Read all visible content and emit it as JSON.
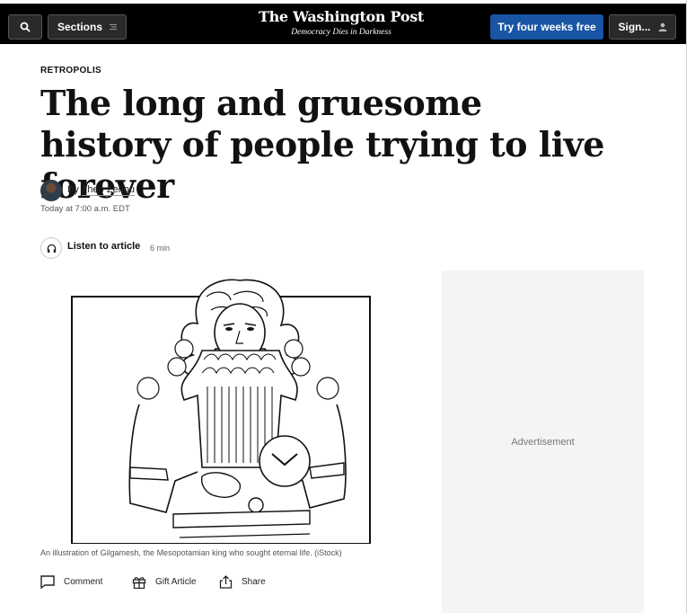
{
  "header": {
    "sections_label": "Sections",
    "logo": "The Washington Post",
    "tagline": "Democracy Dies in Darkness",
    "trial_label": "Try four weeks free",
    "signin_label": "Sign..."
  },
  "article": {
    "kicker": "RETROPOLIS",
    "headline": "The long and gruesome history of people trying to live forever",
    "byline_prefix": "By",
    "author": "Theo Zenou",
    "timestamp": "Today at 7:00 a.m. EDT",
    "listen_label": "Listen to article",
    "listen_duration": "6 min",
    "caption": "An illustration of Gilgamesh, the Mesopotamian king who sought eternal life. (iStock)",
    "actions": {
      "comment": "Comment",
      "gift": "Gift Article",
      "share": "Share"
    }
  },
  "ad": {
    "label": "Advertisement"
  },
  "colors": {
    "header_bg": "#000000",
    "trial_button": "#1955a5",
    "ad_bg": "#f4f4f4"
  },
  "icons": {
    "search": "search-icon",
    "sections": "hamburger-icon",
    "signin": "user-icon",
    "listen": "headphones-icon",
    "comment": "comment-icon",
    "gift": "gift-icon",
    "share": "share-icon"
  }
}
